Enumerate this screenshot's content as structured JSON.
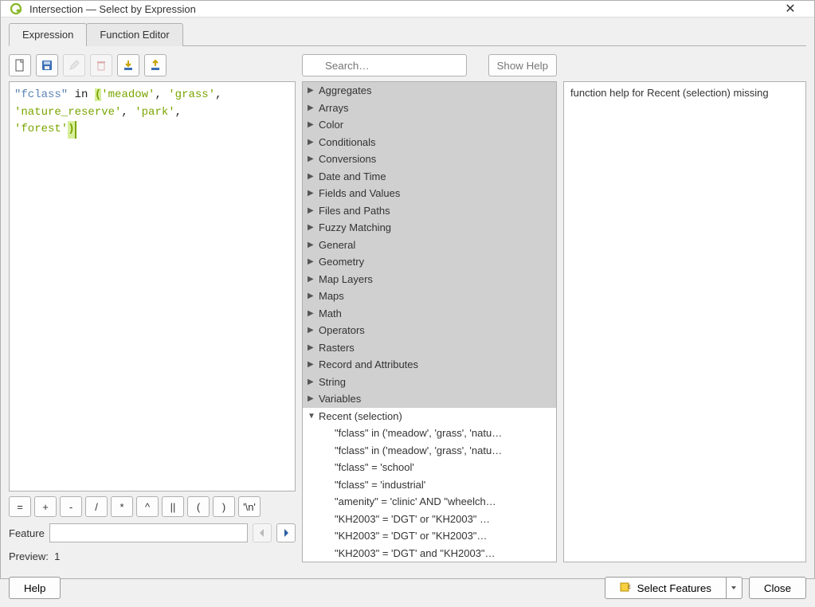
{
  "window": {
    "title": "Intersection — Select by Expression"
  },
  "tabs": {
    "expression": "Expression",
    "function_editor": "Function Editor"
  },
  "toolbar_icons": {
    "new": "new",
    "save": "save",
    "edit": "edit",
    "delete": "delete",
    "import": "import",
    "export": "export"
  },
  "expression": {
    "tokens": {
      "field": "\"fclass\"",
      "kw_in": "in",
      "lparen": "(",
      "s1": "'meadow'",
      "s2": "'grass'",
      "s3": "'nature_reserve'",
      "s4": "'park'",
      "s5": "'forest'",
      "rparen": ")"
    }
  },
  "operators": [
    "=",
    "+",
    "-",
    "/",
    "*",
    "^",
    "||",
    "(",
    ")",
    "'\\n'"
  ],
  "feature": {
    "label": "Feature",
    "value": ""
  },
  "preview": {
    "label": "Preview:",
    "value": "1"
  },
  "search": {
    "placeholder": "Search…"
  },
  "show_help": "Show Help",
  "categories": [
    "Aggregates",
    "Arrays",
    "Color",
    "Conditionals",
    "Conversions",
    "Date and Time",
    "Fields and Values",
    "Files and Paths",
    "Fuzzy Matching",
    "General",
    "Geometry",
    "Map Layers",
    "Maps",
    "Math",
    "Operators",
    "Rasters",
    "Record and Attributes",
    "String",
    "Variables"
  ],
  "recent": {
    "label": "Recent (selection)",
    "items": [
      "\"fclass\" in ('meadow', 'grass', 'natu…",
      "\"fclass\" in ('meadow', 'grass', 'natu…",
      " \"fclass\"  =  'school'",
      " \"fclass\"  =  'industrial'",
      " \"amenity\" = 'clinic' AND \"wheelch…",
      " \"KH2003\"  =  'DGT' or  \"KH2003\" …",
      " \"KH2003\"  =  'DGT' or  \"KH2003\"…",
      " \"KH2003\"  =  'DGT' and  \"KH2003\"…"
    ]
  },
  "help_text": "function help for Recent (selection) missing",
  "buttons": {
    "help": "Help",
    "select_features": "Select Features",
    "close": "Close"
  }
}
